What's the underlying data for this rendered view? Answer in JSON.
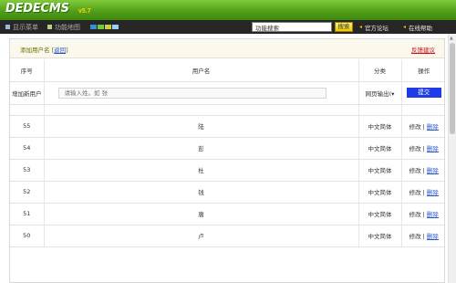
{
  "brand": {
    "logo": "DEDECMS",
    "version": "v5.7"
  },
  "toolbar": {
    "show_menu": "显示菜单",
    "feature_map": "功能地图",
    "swatch_colors": [
      "#3a8fd6",
      "#6fcf3a",
      "#cfd040",
      "#9ad0ff"
    ],
    "search_value": "功能搜索",
    "search_button": "搜索",
    "forum_link": "官方论坛",
    "help_link": "在线帮助"
  },
  "panel": {
    "title": "添加用户名",
    "back_link": "返回",
    "feedback_link": "反馈建议"
  },
  "table": {
    "headers": {
      "id": "序号",
      "name": "用户名",
      "category": "分类",
      "action": "操作"
    },
    "add_row": {
      "label": "增加新用户",
      "placeholder": "请输入姓。如 张",
      "select": "网页输出(▾",
      "submit": "提交"
    },
    "rows": [
      {
        "id": "55",
        "name": "陆",
        "category": "中文简体",
        "edit": "修改",
        "sep": "|",
        "del": "删除"
      },
      {
        "id": "54",
        "name": "彭",
        "category": "中文简体",
        "edit": "修改",
        "sep": "|",
        "del": "删除"
      },
      {
        "id": "53",
        "name": "杜",
        "category": "中文简体",
        "edit": "修改",
        "sep": "|",
        "del": "删除"
      },
      {
        "id": "52",
        "name": "钱",
        "category": "中文简体",
        "edit": "修改",
        "sep": "|",
        "del": "删除"
      },
      {
        "id": "51",
        "name": "唐",
        "category": "中文简体",
        "edit": "修改",
        "sep": "|",
        "del": "删除"
      },
      {
        "id": "50",
        "name": "卢",
        "category": "中文简体",
        "edit": "修改",
        "sep": "|",
        "del": "删除"
      }
    ]
  }
}
